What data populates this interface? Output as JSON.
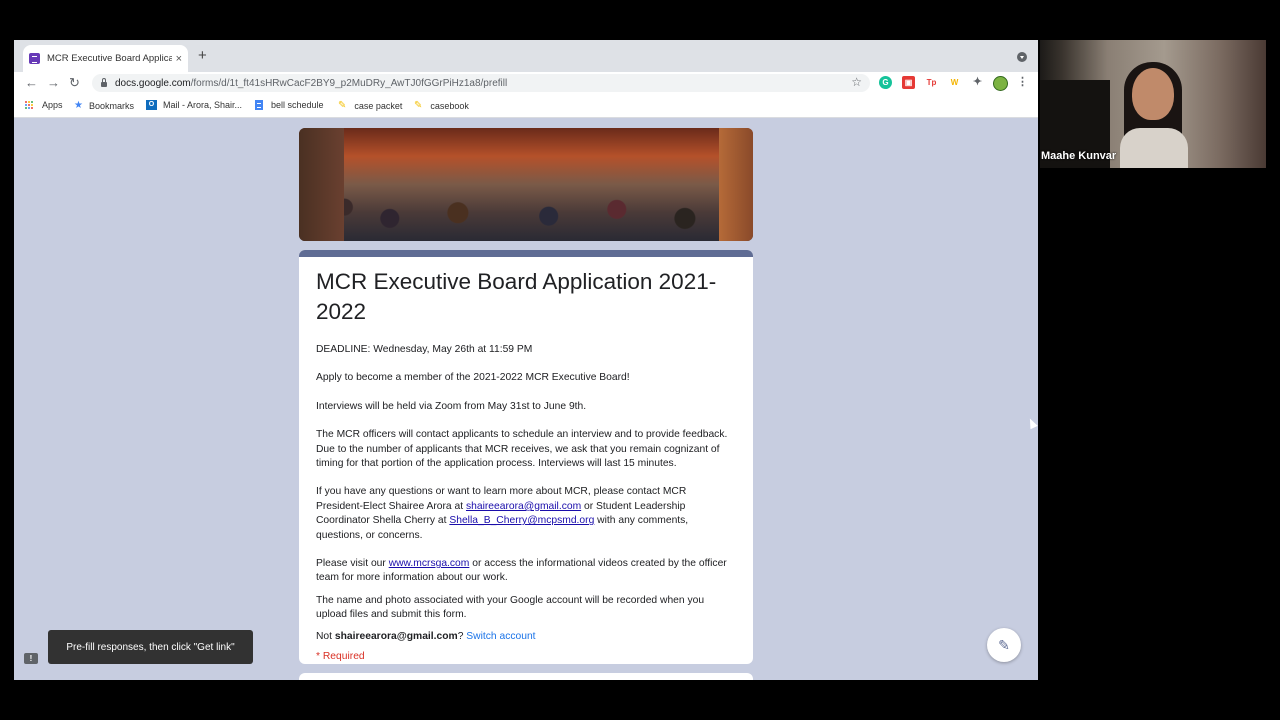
{
  "tab": {
    "title": "MCR Executive Board Applicat",
    "close": "×"
  },
  "toolbar": {
    "back": "←",
    "forward": "→",
    "reload": "↻",
    "url_domain": "docs.google.com",
    "url_path": "/forms/d/1t_ft41sHRwCacF2BY9_p2MuDRy_AwTJ0fGGrPiHz1a8/prefill",
    "star": "☆"
  },
  "newtab_label": "+",
  "extensions": [
    {
      "name": "grammarly-icon",
      "glyph": "G",
      "color": "#15c39a"
    },
    {
      "name": "screencastify-icon",
      "glyph": "▣",
      "color": "#e53935"
    },
    {
      "name": "tp-icon",
      "glyph": "Tp",
      "color": "#e53935"
    },
    {
      "name": "wordtune-icon",
      "glyph": "W",
      "color": "#f4b400"
    }
  ],
  "bookmarks": [
    {
      "label": "Apps",
      "icon": "apps-grid-icon"
    },
    {
      "label": "Bookmarks",
      "icon": "star-icon"
    },
    {
      "label": "Mail - Arora, Shair...",
      "icon": "outlook-icon"
    },
    {
      "label": "bell schedule",
      "icon": "docs-icon"
    },
    {
      "label": "case packet",
      "icon": "pencil-icon"
    },
    {
      "label": "casebook",
      "icon": "pencil-icon"
    }
  ],
  "form": {
    "title": "MCR Executive Board Application 2021-2022",
    "deadline": "DEADLINE: Wednesday, May 26th at 11:59 PM",
    "apply": "Apply to become a member of the 2021-2022 MCR Executive Board!",
    "interviews": "Interviews will be held via Zoom from May 31st to June 9th.",
    "officers": "The MCR officers will contact applicants to schedule an interview and to provide feedback. Due to the number of applicants that MCR receives, we ask that you remain cognizant of timing for that portion of the application process. Interviews will last 15 minutes.",
    "contact_pre": "If you have any questions or want to learn more about MCR, please contact MCR President-Elect Shairee Arora at ",
    "contact_email1": "shaireearora@gmail.com",
    "contact_mid": " or Student Leadership Coordinator Shella Cherry at ",
    "contact_email2": "Shella_B_Cherry@mcpsmd.org",
    "contact_post": " with any comments, questions, or concerns.",
    "visit_pre": "Please visit our ",
    "visit_link": "www.mcrsga.com",
    "visit_post": " or access the informational videos created by the officer team for more information about our work.",
    "recorded": "The name and photo associated with your Google account will be recorded when you upload files and submit this form.",
    "not_pre": "Not ",
    "not_email": "shaireearora@gmail.com",
    "not_q": "? ",
    "switch": "Switch account",
    "required": "* Required"
  },
  "toast": "Pre-fill responses, then click \"Get link\"",
  "feedback_glyph": "!",
  "edit_glyph": "✎",
  "video": {
    "name": "Maahe Kunvar"
  }
}
